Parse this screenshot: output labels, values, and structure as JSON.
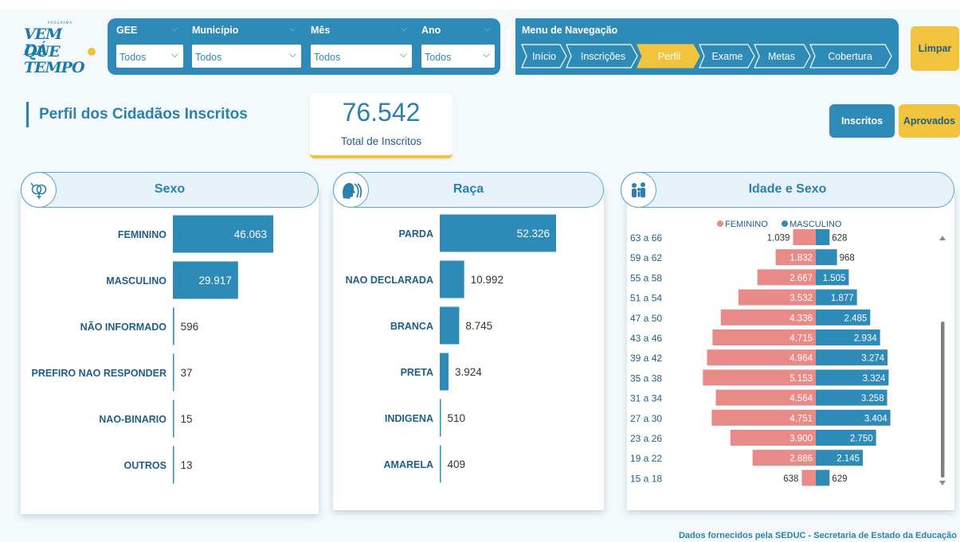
{
  "header": {
    "title": "Programa Vem que Dá Tempo"
  },
  "logo": {
    "small": "PROGRAMA",
    "line1": "VEM QUE",
    "line2": "DÁ TEMPO"
  },
  "filters": [
    {
      "label": "GEE",
      "value": "Todos"
    },
    {
      "label": "Município",
      "value": "Todos"
    },
    {
      "label": "Mês",
      "value": "Todos"
    },
    {
      "label": "Ano",
      "value": "Todos"
    }
  ],
  "nav": {
    "title": "Menu de Navegação",
    "items": [
      "Início",
      "Inscrições",
      "Perfil",
      "Exame",
      "Metas",
      "Cobertura"
    ],
    "active": "Perfil"
  },
  "clear_label": "Limpar",
  "page_title": "Perfil dos Cidadãos Inscritos",
  "kpi": {
    "value": "76.542",
    "label": "Total de Inscritos"
  },
  "toggle": {
    "inscritos": "Inscritos",
    "aprovados": "Aprovados"
  },
  "colors": {
    "primary": "#2e8ab6",
    "accent": "#f2c33c",
    "female": "#e88a88",
    "male": "#2e8ab6"
  },
  "cards": {
    "sexo": {
      "title": "Sexo",
      "icon": "gender-icon"
    },
    "raca": {
      "title": "Raça",
      "icon": "heads-icon"
    },
    "idade": {
      "title": "Idade e Sexo",
      "icon": "family-icon"
    }
  },
  "chart_data": [
    {
      "type": "bar",
      "title": "Sexo",
      "orientation": "horizontal",
      "categories": [
        "FEMININO",
        "MASCULINO",
        "NÃO INFORMADO",
        "PREFIRO NAO RESPONDER",
        "NAO-BINARIO",
        "OUTROS"
      ],
      "values": [
        46063,
        29917,
        596,
        37,
        15,
        13
      ],
      "labels": [
        "46.063",
        "29.917",
        "596",
        "37",
        "15",
        "13"
      ]
    },
    {
      "type": "bar",
      "title": "Raça",
      "orientation": "horizontal",
      "categories": [
        "PARDA",
        "NAO DECLARADA",
        "BRANCA",
        "PRETA",
        "INDIGENA",
        "AMARELA"
      ],
      "values": [
        52326,
        10992,
        8745,
        3924,
        510,
        409
      ],
      "labels": [
        "52.326",
        "10.992",
        "8.745",
        "3.924",
        "510",
        "409"
      ]
    },
    {
      "type": "bar",
      "title": "Idade e Sexo",
      "orientation": "population-pyramid",
      "legend": "top",
      "categories": [
        "63 a 66",
        "59 a 62",
        "55 a 58",
        "51 a 54",
        "47 a 50",
        "43 a 46",
        "39 a 42",
        "35 a 38",
        "31 a 34",
        "27 a 30",
        "23 a 26",
        "19 a 22",
        "15 a 18"
      ],
      "series": [
        {
          "name": "FEMININO",
          "values": [
            1039,
            1832,
            2667,
            3532,
            4336,
            4715,
            4964,
            5153,
            4564,
            4751,
            3900,
            2886,
            638
          ],
          "labels": [
            "1.039",
            "1.832",
            "2.667",
            "3.532",
            "4.336",
            "4.715",
            "4.964",
            "5.153",
            "4.564",
            "4.751",
            "3.900",
            "2.886",
            "638"
          ]
        },
        {
          "name": "MASCULINO",
          "values": [
            628,
            968,
            1505,
            1877,
            2485,
            2934,
            3274,
            3324,
            3258,
            3404,
            2750,
            2145,
            629
          ],
          "labels": [
            "628",
            "968",
            "1.505",
            "1.877",
            "2.485",
            "2.934",
            "3.274",
            "3.324",
            "3.258",
            "3.404",
            "2.750",
            "2.145",
            "629"
          ]
        }
      ]
    }
  ],
  "footer": "Dados fornecidos pela SEDUC - Secretaria de Estado da Educação"
}
